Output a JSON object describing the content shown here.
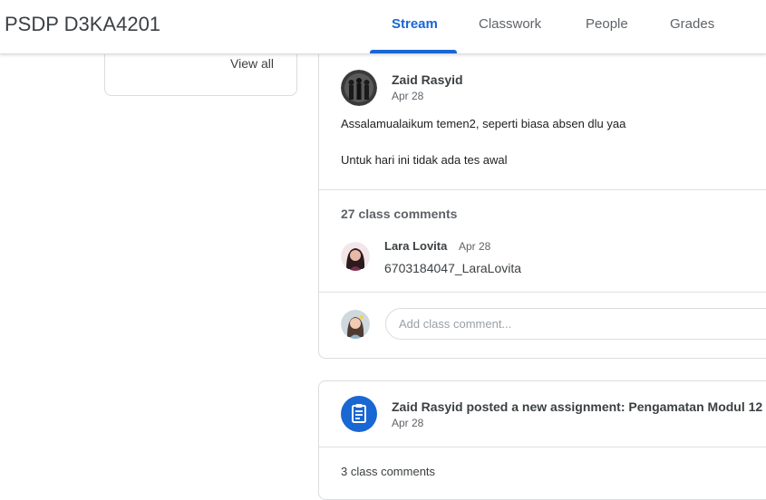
{
  "header": {
    "class_name": "PSDP D3KA4201",
    "tabs": [
      {
        "label": "Stream",
        "active": true
      },
      {
        "label": "Classwork",
        "active": false
      },
      {
        "label": "People",
        "active": false
      },
      {
        "label": "Grades",
        "active": false
      }
    ]
  },
  "sidebar": {
    "view_all_label": "View all"
  },
  "post": {
    "author": "Zaid Rasyid",
    "date": "Apr 28",
    "body": [
      "Assalamualaikum temen2, seperti biasa absen dlu yaa",
      "Untuk hari ini tidak ada tes awal"
    ],
    "comment_count_label": "27 class comments",
    "comment": {
      "author": "Lara Lovita",
      "date": "Apr 28",
      "text": "6703184047_LaraLovita"
    },
    "comment_input_placeholder": "Add class comment..."
  },
  "assignment": {
    "title": "Zaid Rasyid posted a new assignment: Pengamatan Modul 12",
    "date": "Apr 28",
    "comment_count_label": "3 class comments"
  },
  "colors": {
    "accent": "#1967d2",
    "border": "#dadce0"
  }
}
